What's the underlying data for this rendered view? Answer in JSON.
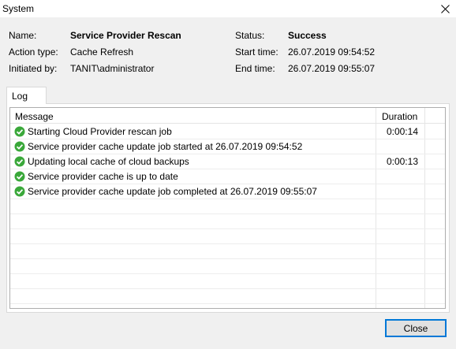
{
  "window": {
    "title": "System"
  },
  "summary": {
    "name_label": "Name:",
    "name_value": "Service Provider Rescan",
    "action_label": "Action type:",
    "action_value": "Cache Refresh",
    "initiated_label": "Initiated by:",
    "initiated_value": "TANIT\\administrator",
    "status_label": "Status:",
    "status_value": "Success",
    "start_label": "Start time:",
    "start_value": "26.07.2019 09:54:52",
    "end_label": "End time:",
    "end_value": "26.07.2019 09:55:07"
  },
  "tabs": [
    {
      "label": "Log"
    }
  ],
  "log": {
    "columns": {
      "message": "Message",
      "duration": "Duration"
    },
    "rows": [
      {
        "message": "Starting Cloud Provider rescan job",
        "duration": "0:00:14",
        "status_icon": "success-check-icon"
      },
      {
        "message": "Service  provider cache update job started at 26.07.2019 09:54:52",
        "duration": "",
        "status_icon": "success-check-icon"
      },
      {
        "message": "Updating local cache of cloud backups",
        "duration": "0:00:13",
        "status_icon": "success-check-icon"
      },
      {
        "message": "Service provider cache is up to date",
        "duration": "",
        "status_icon": "success-check-icon"
      },
      {
        "message": "Service provider cache update job completed at 26.07.2019 09:55:07",
        "duration": "",
        "status_icon": "success-check-icon"
      }
    ]
  },
  "buttons": {
    "close_label": "Close"
  },
  "colors": {
    "success_green": "#3aa83a",
    "accent_blue": "#0078d7"
  }
}
